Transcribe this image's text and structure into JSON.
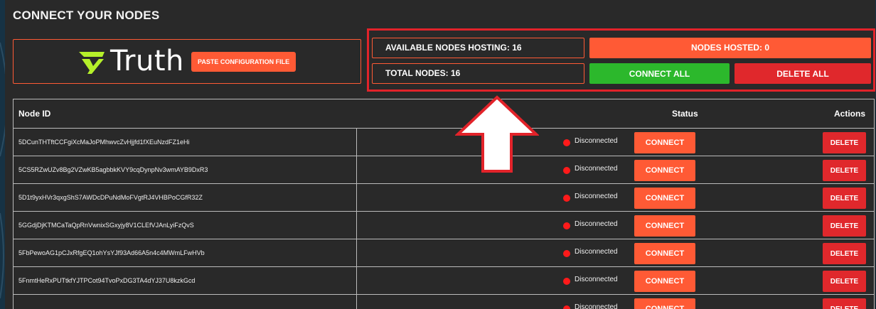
{
  "header": {
    "title": "CONNECT YOUR NODES"
  },
  "logo": {
    "text": "Truth",
    "mark_icon": "truth-logo-mark-icon"
  },
  "paste_button": {
    "label": "PASTE CONFIGURATION FILE"
  },
  "stats": {
    "available": "AVAILABLE NODES HOSTING: 16",
    "total": "TOTAL NODES: 16",
    "hosted": "NODES HOSTED: 0"
  },
  "actions": {
    "connect_all": "CONNECT ALL",
    "delete_all": "DELETE ALL"
  },
  "table": {
    "columns": {
      "node_id": "Node ID",
      "status": "Status",
      "actions": "Actions"
    },
    "rows": [
      {
        "id": "5DCunTHTftCCFgiXcMaJoPMhwvcZvHjjfd1fXEuNzdFZ1eHi",
        "status": "Disconnected",
        "connect": "CONNECT",
        "delete": "DELETE"
      },
      {
        "id": "5CS5RZwUZv8Bg2VZwKB5agbbkKVY9cqDynpNv3wmAYB9DxR3",
        "status": "Disconnected",
        "connect": "CONNECT",
        "delete": "DELETE"
      },
      {
        "id": "5D1t9yxHVr3qxgShS7AWDcDPuNdMoFVgtRJ4VHBPoCGfR32Z",
        "status": "Disconnected",
        "connect": "CONNECT",
        "delete": "DELETE"
      },
      {
        "id": "5GGdjDjKTMCaTaQpRnVwnixSGxyjy8V1CLEfVJAnLyiFzQvS",
        "status": "Disconnected",
        "connect": "CONNECT",
        "delete": "DELETE"
      },
      {
        "id": "5FbPewoAG1pCJxRfgEQ1ohYsYJf93Ad66A5n4c4MWmLFwHVb",
        "status": "Disconnected",
        "connect": "CONNECT",
        "delete": "DELETE"
      },
      {
        "id": "5FnmtHeRxPUTtkfYJTPCot94TvoPxDG3TA4dYJ37U8kzkGcd",
        "status": "Disconnected",
        "connect": "CONNECT",
        "delete": "DELETE"
      },
      {
        "id": "",
        "status": "Disconnected",
        "connect": "CONNECT",
        "delete": "DELETE"
      }
    ]
  },
  "colors": {
    "accent": "#ff5a35",
    "connect_all": "#2cb82c",
    "delete": "#e0282c",
    "status_dot": "#ff1a1a",
    "annotation": "#e2232a"
  },
  "annotation_icon": "up-arrow-icon"
}
